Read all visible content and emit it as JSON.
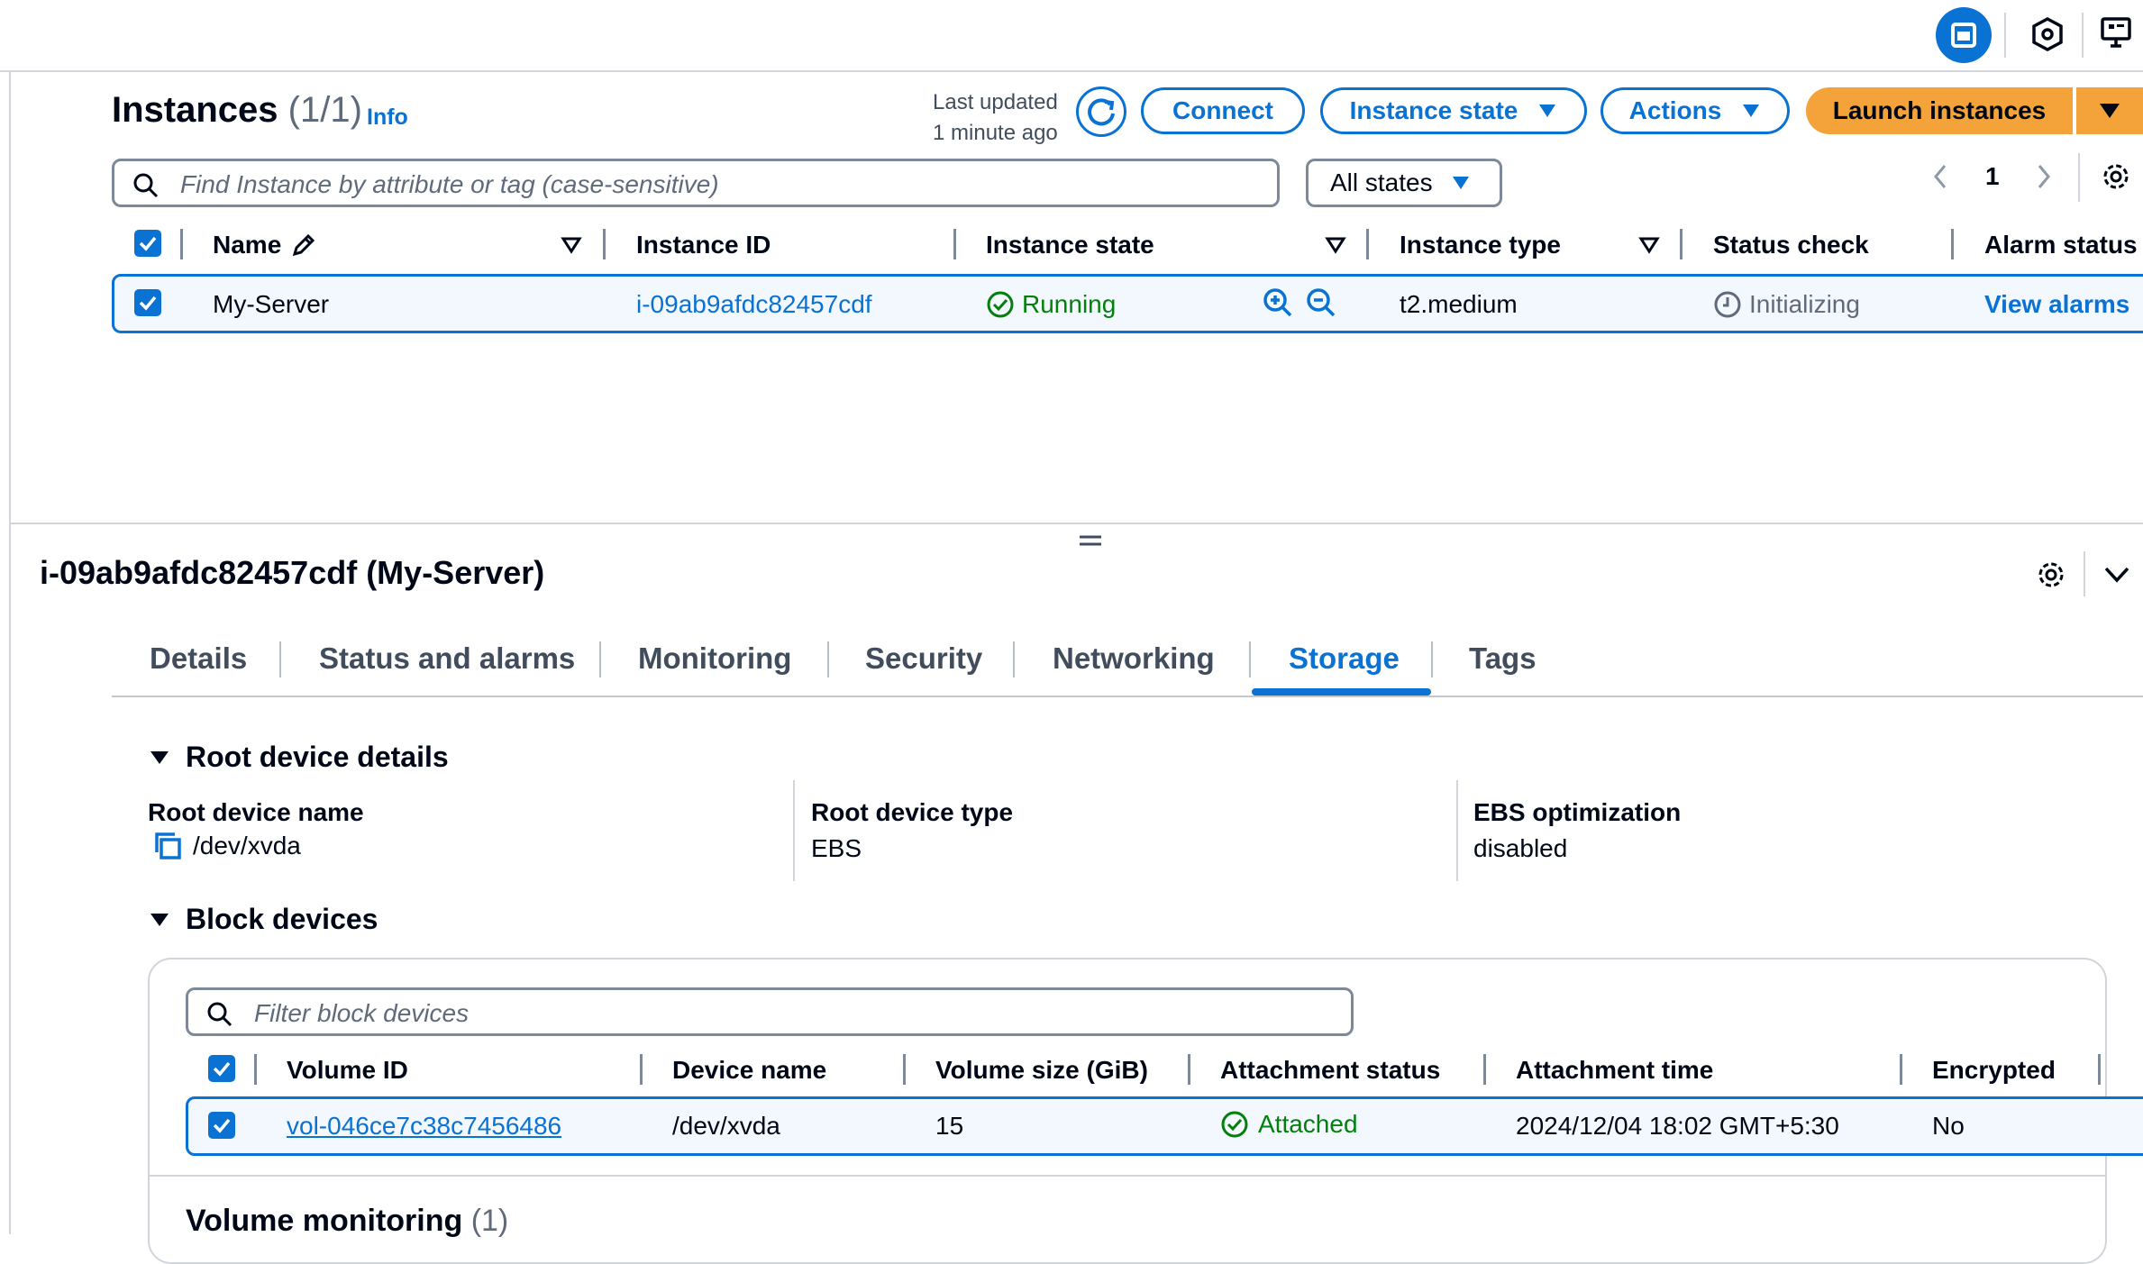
{
  "instances": {
    "title": "Instances",
    "count": "(1/1)",
    "info": "Info",
    "last_updated_line1": "Last updated",
    "last_updated_line2": "1 minute ago",
    "connect": "Connect",
    "instance_state_btn": "Instance state",
    "actions": "Actions",
    "launch": "Launch instances",
    "search_placeholder": "Find Instance by attribute or tag (case-sensitive)",
    "states_filter": "All states",
    "page": "1",
    "columns": [
      "Name",
      "Instance ID",
      "Instance state",
      "Instance type",
      "Status check",
      "Alarm status"
    ],
    "row": {
      "name": "My-Server",
      "id": "i-09ab9afdc82457cdf",
      "state": "Running",
      "type": "t2.medium",
      "status_check": "Initializing",
      "alarm": "View alarms"
    }
  },
  "detail": {
    "title": "i-09ab9afdc82457cdf (My-Server)",
    "tabs": [
      "Details",
      "Status and alarms",
      "Monitoring",
      "Security",
      "Networking",
      "Storage",
      "Tags"
    ],
    "active_tab": "Storage",
    "root_section": "Root device details",
    "root_name_label": "Root device name",
    "root_name_value": "/dev/xvda",
    "root_type_label": "Root device type",
    "root_type_value": "EBS",
    "ebs_opt_label": "EBS optimization",
    "ebs_opt_value": "disabled",
    "block_section": "Block devices",
    "filter_placeholder": "Filter block devices",
    "block_columns": [
      "Volume ID",
      "Device name",
      "Volume size (GiB)",
      "Attachment status",
      "Attachment time",
      "Encrypted"
    ],
    "block_row": {
      "volume_id": "vol-046ce7c38c7456486",
      "device": "/dev/xvda",
      "size": "15",
      "status": "Attached",
      "time": "2024/12/04 18:02 GMT+5:30",
      "encrypted": "No"
    },
    "monitoring_title": "Volume monitoring",
    "monitoring_count": "(1)"
  },
  "colors": {
    "accent": "#0972d3",
    "launch": "#f3a33a",
    "success": "#037f0c",
    "text": "#000716"
  }
}
